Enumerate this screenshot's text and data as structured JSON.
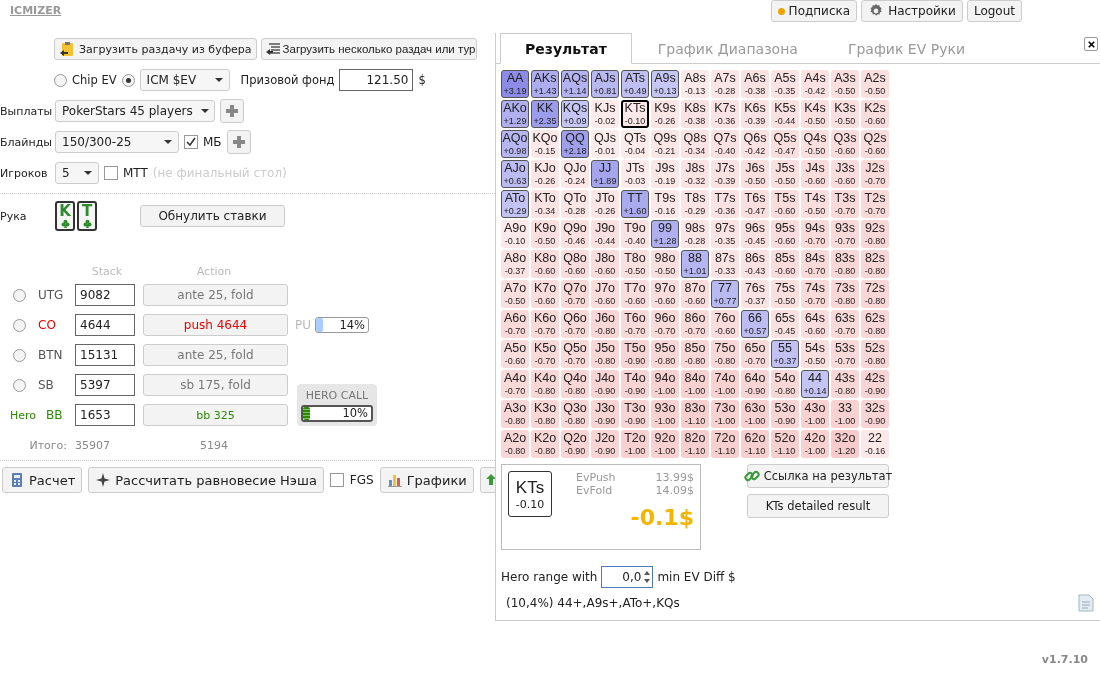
{
  "app": {
    "logo": "ICMIZER",
    "version": "v1.7.10"
  },
  "header_buttons": [
    {
      "label": "Подписка",
      "kind": "dot"
    },
    {
      "label": "Настройки",
      "kind": "gear"
    },
    {
      "label": "Logout",
      "kind": "plain"
    }
  ],
  "load_buttons": [
    {
      "label": "Загрузить раздачу из буфера",
      "kind": "clipboard"
    },
    {
      "label": "Загрузить несколько раздач или тур",
      "kind": "list"
    }
  ],
  "mode": {
    "chip_ev": {
      "label": "Chip EV",
      "selected": false
    },
    "icm": {
      "selected": true,
      "value": "ICM $EV"
    },
    "prize_label": "Призовой фонд",
    "prize_value": "121.50",
    "prize_unit": "$"
  },
  "payouts": {
    "label": "Выплаты",
    "value": "PokerStars 45 players"
  },
  "blinds": {
    "label": "Блайнды",
    "value": "150/300-25",
    "mb_label": "МБ",
    "mb_checked": true
  },
  "players_count": {
    "label": "Игроков",
    "value": "5",
    "mtt_label": "MTT",
    "mtt_checked": false,
    "mtt_note": "(не финальный стол)"
  },
  "hand": {
    "label": "Рука",
    "cards": [
      "K",
      "T"
    ],
    "reset_button": "Обнулить ставки"
  },
  "table": {
    "stack_header": "Stack",
    "action_header": "Action",
    "players": [
      {
        "position": "UTG",
        "stack": "9082",
        "action": "ante 25, fold",
        "kind": "fold",
        "selected": false
      },
      {
        "position": "CO",
        "stack": "4644",
        "action": "push 4644",
        "kind": "push",
        "selected": false,
        "range": {
          "label": "PU",
          "value": "14%",
          "level": 0.14
        }
      },
      {
        "position": "BTN",
        "stack": "15131",
        "action": "ante 25, fold",
        "kind": "fold",
        "selected": false
      },
      {
        "position": "SB",
        "stack": "5397",
        "action": "sb 175, fold",
        "kind": "fold",
        "selected": false
      },
      {
        "position": "BB",
        "stack": "1653",
        "action": "bb 325",
        "kind": "hero",
        "hero_label": "Hero"
      }
    ],
    "hero_call": {
      "title": "HERO CALL",
      "value": "10%",
      "level": 0.1
    },
    "total_label": "Итого:",
    "total_stack": "35907",
    "total_action": "5194"
  },
  "actions": {
    "calc": "Расчет",
    "nash": "Рассчитать равновесие Нэша",
    "fgs_label": "FGS",
    "fgs_checked": false,
    "charts": "Графики"
  },
  "result_panel": {
    "tabs": [
      {
        "label": "Результат",
        "selected": true
      },
      {
        "label": "График Диапазона",
        "selected": false
      },
      {
        "label": "График EV Руки",
        "selected": false
      }
    ],
    "grid": [
      [
        {
          "hand": "AA",
          "ev": "+3.19",
          "in_range": true,
          "selected": false
        },
        {
          "hand": "AKs",
          "ev": "+1.43",
          "in_range": true,
          "selected": false
        },
        {
          "hand": "AQs",
          "ev": "+1.14",
          "in_range": true,
          "selected": false
        },
        {
          "hand": "AJs",
          "ev": "+0.81",
          "in_range": true,
          "selected": false
        },
        {
          "hand": "ATs",
          "ev": "+0.49",
          "in_range": true,
          "selected": false
        },
        {
          "hand": "A9s",
          "ev": "+0.13",
          "in_range": true,
          "selected": false
        },
        {
          "hand": "A8s",
          "ev": "-0.13",
          "in_range": false,
          "selected": false
        },
        {
          "hand": "A7s",
          "ev": "-0.28",
          "in_range": false,
          "selected": false
        },
        {
          "hand": "A6s",
          "ev": "-0.38",
          "in_range": false,
          "selected": false
        },
        {
          "hand": "A5s",
          "ev": "-0.35",
          "in_range": false,
          "selected": false
        },
        {
          "hand": "A4s",
          "ev": "-0.42",
          "in_range": false,
          "selected": false
        },
        {
          "hand": "A3s",
          "ev": "-0.50",
          "in_range": false,
          "selected": false
        },
        {
          "hand": "A2s",
          "ev": "-0.50",
          "in_range": false,
          "selected": false
        }
      ],
      [
        {
          "hand": "AKo",
          "ev": "+1.29",
          "in_range": true,
          "selected": false
        },
        {
          "hand": "KK",
          "ev": "+2.35",
          "in_range": true,
          "selected": false
        },
        {
          "hand": "KQs",
          "ev": "+0.09",
          "in_range": true,
          "selected": false
        },
        {
          "hand": "KJs",
          "ev": "-0.02",
          "in_range": false,
          "selected": false
        },
        {
          "hand": "KTs",
          "ev": "-0.10",
          "in_range": false,
          "selected": true
        },
        {
          "hand": "K9s",
          "ev": "-0.26",
          "in_range": false,
          "selected": false
        },
        {
          "hand": "K8s",
          "ev": "-0.38",
          "in_range": false,
          "selected": false
        },
        {
          "hand": "K7s",
          "ev": "-0.36",
          "in_range": false,
          "selected": false
        },
        {
          "hand": "K6s",
          "ev": "-0.39",
          "in_range": false,
          "selected": false
        },
        {
          "hand": "K5s",
          "ev": "-0.44",
          "in_range": false,
          "selected": false
        },
        {
          "hand": "K4s",
          "ev": "-0.50",
          "in_range": false,
          "selected": false
        },
        {
          "hand": "K3s",
          "ev": "-0.50",
          "in_range": false,
          "selected": false
        },
        {
          "hand": "K2s",
          "ev": "-0.60",
          "in_range": false,
          "selected": false
        }
      ],
      [
        {
          "hand": "AQo",
          "ev": "+0.98",
          "in_range": true,
          "selected": false
        },
        {
          "hand": "KQo",
          "ev": "-0.15",
          "in_range": false,
          "selected": false
        },
        {
          "hand": "QQ",
          "ev": "+2.18",
          "in_range": true,
          "selected": false
        },
        {
          "hand": "QJs",
          "ev": "-0.01",
          "in_range": false,
          "selected": false
        },
        {
          "hand": "QTs",
          "ev": "-0.04",
          "in_range": false,
          "selected": false
        },
        {
          "hand": "Q9s",
          "ev": "-0.21",
          "in_range": false,
          "selected": false
        },
        {
          "hand": "Q8s",
          "ev": "-0.34",
          "in_range": false,
          "selected": false
        },
        {
          "hand": "Q7s",
          "ev": "-0.40",
          "in_range": false,
          "selected": false
        },
        {
          "hand": "Q6s",
          "ev": "-0.42",
          "in_range": false,
          "selected": false
        },
        {
          "hand": "Q5s",
          "ev": "-0.47",
          "in_range": false,
          "selected": false
        },
        {
          "hand": "Q4s",
          "ev": "-0.50",
          "in_range": false,
          "selected": false
        },
        {
          "hand": "Q3s",
          "ev": "-0.60",
          "in_range": false,
          "selected": false
        },
        {
          "hand": "Q2s",
          "ev": "-0.60",
          "in_range": false,
          "selected": false
        }
      ],
      [
        {
          "hand": "AJo",
          "ev": "+0.63",
          "in_range": true,
          "selected": false
        },
        {
          "hand": "KJo",
          "ev": "-0.26",
          "in_range": false,
          "selected": false
        },
        {
          "hand": "QJo",
          "ev": "-0.24",
          "in_range": false,
          "selected": false
        },
        {
          "hand": "JJ",
          "ev": "+1.89",
          "in_range": true,
          "selected": false
        },
        {
          "hand": "JTs",
          "ev": "-0.03",
          "in_range": false,
          "selected": false
        },
        {
          "hand": "J9s",
          "ev": "-0.19",
          "in_range": false,
          "selected": false
        },
        {
          "hand": "J8s",
          "ev": "-0.32",
          "in_range": false,
          "selected": false
        },
        {
          "hand": "J7s",
          "ev": "-0.39",
          "in_range": false,
          "selected": false
        },
        {
          "hand": "J6s",
          "ev": "-0.50",
          "in_range": false,
          "selected": false
        },
        {
          "hand": "J5s",
          "ev": "-0.50",
          "in_range": false,
          "selected": false
        },
        {
          "hand": "J4s",
          "ev": "-0.60",
          "in_range": false,
          "selected": false
        },
        {
          "hand": "J3s",
          "ev": "-0.60",
          "in_range": false,
          "selected": false
        },
        {
          "hand": "J2s",
          "ev": "-0.70",
          "in_range": false,
          "selected": false
        }
      ],
      [
        {
          "hand": "ATo",
          "ev": "+0.29",
          "in_range": true,
          "selected": false
        },
        {
          "hand": "KTo",
          "ev": "-0.34",
          "in_range": false,
          "selected": false
        },
        {
          "hand": "QTo",
          "ev": "-0.28",
          "in_range": false,
          "selected": false
        },
        {
          "hand": "JTo",
          "ev": "-0.26",
          "in_range": false,
          "selected": false
        },
        {
          "hand": "TT",
          "ev": "+1.60",
          "in_range": true,
          "selected": false
        },
        {
          "hand": "T9s",
          "ev": "-0.16",
          "in_range": false,
          "selected": false
        },
        {
          "hand": "T8s",
          "ev": "-0.29",
          "in_range": false,
          "selected": false
        },
        {
          "hand": "T7s",
          "ev": "-0.36",
          "in_range": false,
          "selected": false
        },
        {
          "hand": "T6s",
          "ev": "-0.47",
          "in_range": false,
          "selected": false
        },
        {
          "hand": "T5s",
          "ev": "-0.60",
          "in_range": false,
          "selected": false
        },
        {
          "hand": "T4s",
          "ev": "-0.50",
          "in_range": false,
          "selected": false
        },
        {
          "hand": "T3s",
          "ev": "-0.70",
          "in_range": false,
          "selected": false
        },
        {
          "hand": "T2s",
          "ev": "-0.70",
          "in_range": false,
          "selected": false
        }
      ],
      [
        {
          "hand": "A9o",
          "ev": "-0.10",
          "in_range": false,
          "selected": false
        },
        {
          "hand": "K9o",
          "ev": "-0.50",
          "in_range": false,
          "selected": false
        },
        {
          "hand": "Q9o",
          "ev": "-0.46",
          "in_range": false,
          "selected": false
        },
        {
          "hand": "J9o",
          "ev": "-0.44",
          "in_range": false,
          "selected": false
        },
        {
          "hand": "T9o",
          "ev": "-0.40",
          "in_range": false,
          "selected": false
        },
        {
          "hand": "99",
          "ev": "+1.28",
          "in_range": true,
          "selected": false
        },
        {
          "hand": "98s",
          "ev": "-0.28",
          "in_range": false,
          "selected": false
        },
        {
          "hand": "97s",
          "ev": "-0.35",
          "in_range": false,
          "selected": false
        },
        {
          "hand": "96s",
          "ev": "-0.45",
          "in_range": false,
          "selected": false
        },
        {
          "hand": "95s",
          "ev": "-0.60",
          "in_range": false,
          "selected": false
        },
        {
          "hand": "94s",
          "ev": "-0.70",
          "in_range": false,
          "selected": false
        },
        {
          "hand": "93s",
          "ev": "-0.70",
          "in_range": false,
          "selected": false
        },
        {
          "hand": "92s",
          "ev": "-0.80",
          "in_range": false,
          "selected": false
        }
      ],
      [
        {
          "hand": "A8o",
          "ev": "-0.37",
          "in_range": false,
          "selected": false
        },
        {
          "hand": "K8o",
          "ev": "-0.60",
          "in_range": false,
          "selected": false
        },
        {
          "hand": "Q8o",
          "ev": "-0.60",
          "in_range": false,
          "selected": false
        },
        {
          "hand": "J8o",
          "ev": "-0.60",
          "in_range": false,
          "selected": false
        },
        {
          "hand": "T8o",
          "ev": "-0.50",
          "in_range": false,
          "selected": false
        },
        {
          "hand": "98o",
          "ev": "-0.50",
          "in_range": false,
          "selected": false
        },
        {
          "hand": "88",
          "ev": "+1.01",
          "in_range": true,
          "selected": false
        },
        {
          "hand": "87s",
          "ev": "-0.33",
          "in_range": false,
          "selected": false
        },
        {
          "hand": "86s",
          "ev": "-0.43",
          "in_range": false,
          "selected": false
        },
        {
          "hand": "85s",
          "ev": "-0.60",
          "in_range": false,
          "selected": false
        },
        {
          "hand": "84s",
          "ev": "-0.70",
          "in_range": false,
          "selected": false
        },
        {
          "hand": "83s",
          "ev": "-0.80",
          "in_range": false,
          "selected": false
        },
        {
          "hand": "82s",
          "ev": "-0.80",
          "in_range": false,
          "selected": false
        }
      ],
      [
        {
          "hand": "A7o",
          "ev": "-0.50",
          "in_range": false,
          "selected": false
        },
        {
          "hand": "K7o",
          "ev": "-0.60",
          "in_range": false,
          "selected": false
        },
        {
          "hand": "Q7o",
          "ev": "-0.70",
          "in_range": false,
          "selected": false
        },
        {
          "hand": "J7o",
          "ev": "-0.60",
          "in_range": false,
          "selected": false
        },
        {
          "hand": "T7o",
          "ev": "-0.60",
          "in_range": false,
          "selected": false
        },
        {
          "hand": "97o",
          "ev": "-0.60",
          "in_range": false,
          "selected": false
        },
        {
          "hand": "87o",
          "ev": "-0.60",
          "in_range": false,
          "selected": false
        },
        {
          "hand": "77",
          "ev": "+0.77",
          "in_range": true,
          "selected": false
        },
        {
          "hand": "76s",
          "ev": "-0.37",
          "in_range": false,
          "selected": false
        },
        {
          "hand": "75s",
          "ev": "-0.50",
          "in_range": false,
          "selected": false
        },
        {
          "hand": "74s",
          "ev": "-0.70",
          "in_range": false,
          "selected": false
        },
        {
          "hand": "73s",
          "ev": "-0.80",
          "in_range": false,
          "selected": false
        },
        {
          "hand": "72s",
          "ev": "-0.80",
          "in_range": false,
          "selected": false
        }
      ],
      [
        {
          "hand": "A6o",
          "ev": "-0.70",
          "in_range": false,
          "selected": false
        },
        {
          "hand": "K6o",
          "ev": "-0.70",
          "in_range": false,
          "selected": false
        },
        {
          "hand": "Q6o",
          "ev": "-0.70",
          "in_range": false,
          "selected": false
        },
        {
          "hand": "J6o",
          "ev": "-0.80",
          "in_range": false,
          "selected": false
        },
        {
          "hand": "T6o",
          "ev": "-0.70",
          "in_range": false,
          "selected": false
        },
        {
          "hand": "96o",
          "ev": "-0.70",
          "in_range": false,
          "selected": false
        },
        {
          "hand": "86o",
          "ev": "-0.70",
          "in_range": false,
          "selected": false
        },
        {
          "hand": "76o",
          "ev": "-0.60",
          "in_range": false,
          "selected": false
        },
        {
          "hand": "66",
          "ev": "+0.57",
          "in_range": true,
          "selected": false
        },
        {
          "hand": "65s",
          "ev": "-0.45",
          "in_range": false,
          "selected": false
        },
        {
          "hand": "64s",
          "ev": "-0.60",
          "in_range": false,
          "selected": false
        },
        {
          "hand": "63s",
          "ev": "-0.70",
          "in_range": false,
          "selected": false
        },
        {
          "hand": "62s",
          "ev": "-0.80",
          "in_range": false,
          "selected": false
        }
      ],
      [
        {
          "hand": "A5o",
          "ev": "-0.60",
          "in_range": false,
          "selected": false
        },
        {
          "hand": "K5o",
          "ev": "-0.70",
          "in_range": false,
          "selected": false
        },
        {
          "hand": "Q5o",
          "ev": "-0.70",
          "in_range": false,
          "selected": false
        },
        {
          "hand": "J5o",
          "ev": "-0.80",
          "in_range": false,
          "selected": false
        },
        {
          "hand": "T5o",
          "ev": "-0.90",
          "in_range": false,
          "selected": false
        },
        {
          "hand": "95o",
          "ev": "-0.80",
          "in_range": false,
          "selected": false
        },
        {
          "hand": "85o",
          "ev": "-0.80",
          "in_range": false,
          "selected": false
        },
        {
          "hand": "75o",
          "ev": "-0.80",
          "in_range": false,
          "selected": false
        },
        {
          "hand": "65o",
          "ev": "-0.70",
          "in_range": false,
          "selected": false
        },
        {
          "hand": "55",
          "ev": "+0.37",
          "in_range": true,
          "selected": false
        },
        {
          "hand": "54s",
          "ev": "-0.50",
          "in_range": false,
          "selected": false
        },
        {
          "hand": "53s",
          "ev": "-0.70",
          "in_range": false,
          "selected": false
        },
        {
          "hand": "52s",
          "ev": "-0.80",
          "in_range": false,
          "selected": false
        }
      ],
      [
        {
          "hand": "A4o",
          "ev": "-0.70",
          "in_range": false,
          "selected": false
        },
        {
          "hand": "K4o",
          "ev": "-0.80",
          "in_range": false,
          "selected": false
        },
        {
          "hand": "Q4o",
          "ev": "-0.80",
          "in_range": false,
          "selected": false
        },
        {
          "hand": "J4o",
          "ev": "-0.90",
          "in_range": false,
          "selected": false
        },
        {
          "hand": "T4o",
          "ev": "-0.90",
          "in_range": false,
          "selected": false
        },
        {
          "hand": "94o",
          "ev": "-1.00",
          "in_range": false,
          "selected": false
        },
        {
          "hand": "84o",
          "ev": "-1.00",
          "in_range": false,
          "selected": false
        },
        {
          "hand": "74o",
          "ev": "-1.00",
          "in_range": false,
          "selected": false
        },
        {
          "hand": "64o",
          "ev": "-0.90",
          "in_range": false,
          "selected": false
        },
        {
          "hand": "54o",
          "ev": "-0.80",
          "in_range": false,
          "selected": false
        },
        {
          "hand": "44",
          "ev": "+0.14",
          "in_range": true,
          "selected": false
        },
        {
          "hand": "43s",
          "ev": "-0.80",
          "in_range": false,
          "selected": false
        },
        {
          "hand": "42s",
          "ev": "-0.90",
          "in_range": false,
          "selected": false
        }
      ],
      [
        {
          "hand": "A3o",
          "ev": "-0.80",
          "in_range": false,
          "selected": false
        },
        {
          "hand": "K3o",
          "ev": "-0.80",
          "in_range": false,
          "selected": false
        },
        {
          "hand": "Q3o",
          "ev": "-0.80",
          "in_range": false,
          "selected": false
        },
        {
          "hand": "J3o",
          "ev": "-0.90",
          "in_range": false,
          "selected": false
        },
        {
          "hand": "T3o",
          "ev": "-0.90",
          "in_range": false,
          "selected": false
        },
        {
          "hand": "93o",
          "ev": "-1.00",
          "in_range": false,
          "selected": false
        },
        {
          "hand": "83o",
          "ev": "-1.10",
          "in_range": false,
          "selected": false
        },
        {
          "hand": "73o",
          "ev": "-1.00",
          "in_range": false,
          "selected": false
        },
        {
          "hand": "63o",
          "ev": "-1.00",
          "in_range": false,
          "selected": false
        },
        {
          "hand": "53o",
          "ev": "-0.90",
          "in_range": false,
          "selected": false
        },
        {
          "hand": "43o",
          "ev": "-1.00",
          "in_range": false,
          "selected": false
        },
        {
          "hand": "33",
          "ev": "-1.00",
          "in_range": false,
          "selected": false
        },
        {
          "hand": "32s",
          "ev": "-0.90",
          "in_range": false,
          "selected": false
        }
      ],
      [
        {
          "hand": "A2o",
          "ev": "-0.80",
          "in_range": false,
          "selected": false
        },
        {
          "hand": "K2o",
          "ev": "-0.80",
          "in_range": false,
          "selected": false
        },
        {
          "hand": "Q2o",
          "ev": "-0.90",
          "in_range": false,
          "selected": false
        },
        {
          "hand": "J2o",
          "ev": "-0.90",
          "in_range": false,
          "selected": false
        },
        {
          "hand": "T2o",
          "ev": "-1.00",
          "in_range": false,
          "selected": false
        },
        {
          "hand": "92o",
          "ev": "-1.00",
          "in_range": false,
          "selected": false
        },
        {
          "hand": "82o",
          "ev": "-1.10",
          "in_range": false,
          "selected": false
        },
        {
          "hand": "72o",
          "ev": "-1.10",
          "in_range": false,
          "selected": false
        },
        {
          "hand": "62o",
          "ev": "-1.10",
          "in_range": false,
          "selected": false
        },
        {
          "hand": "52o",
          "ev": "-1.10",
          "in_range": false,
          "selected": false
        },
        {
          "hand": "42o",
          "ev": "-1.00",
          "in_range": false,
          "selected": false
        },
        {
          "hand": "32o",
          "ev": "-1.20",
          "in_range": false,
          "selected": false
        },
        {
          "hand": "22",
          "ev": "-0.16",
          "in_range": false,
          "selected": false
        }
      ]
    ],
    "detail": {
      "hand": "KTs",
      "ev": "-0.10",
      "ev_push_label": "EvPush",
      "ev_push": "13.99$",
      "ev_fold_label": "EvFold",
      "ev_fold": "14.09$",
      "diff": "-0.1$"
    },
    "link_button": "Ссылка на результат",
    "detail_button": "KTs detailed result",
    "hero_range": {
      "label": "Hero range with",
      "value": "0,0",
      "suffix": "min EV Diff $"
    },
    "range_summary": "(10,4%) 44+,A9s+,ATo+,KQs"
  }
}
